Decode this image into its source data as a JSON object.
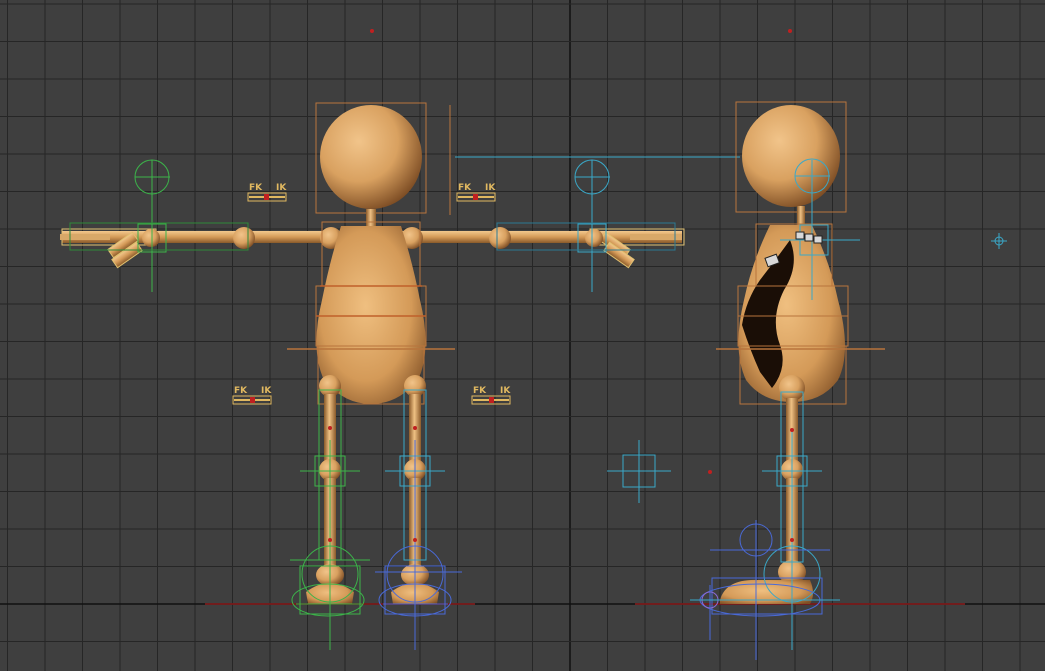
{
  "viewport": {
    "colors": {
      "background": "#3f3f3f",
      "grid": "#262626",
      "grid_axis": "#111111",
      "ground_line": "#8a1a1a",
      "body_light": "#e8b878",
      "body_mid": "#d49a58",
      "body_dark": "#8a5a2a",
      "bone_box": "#b8743c",
      "fk_ik_slider": "#e0b860",
      "ik_green": "#3cb44a",
      "ik_cyan": "#3aa8c8",
      "ik_blue": "#4a6ad8",
      "origin_marker": "#c02020"
    },
    "fk_ik_switches": [
      {
        "fk_label": "FK",
        "ik_label": "IK"
      },
      {
        "fk_label": "FK",
        "ik_label": "IK"
      },
      {
        "fk_label": "FK",
        "ik_label": "IK"
      },
      {
        "fk_label": "FK",
        "ik_label": "IK"
      }
    ],
    "icons": [
      "cross-helper-icon",
      "point-helper-icon",
      "ik-circle-controller-icon",
      "bone-box-icon",
      "origin-marker-icon"
    ]
  }
}
